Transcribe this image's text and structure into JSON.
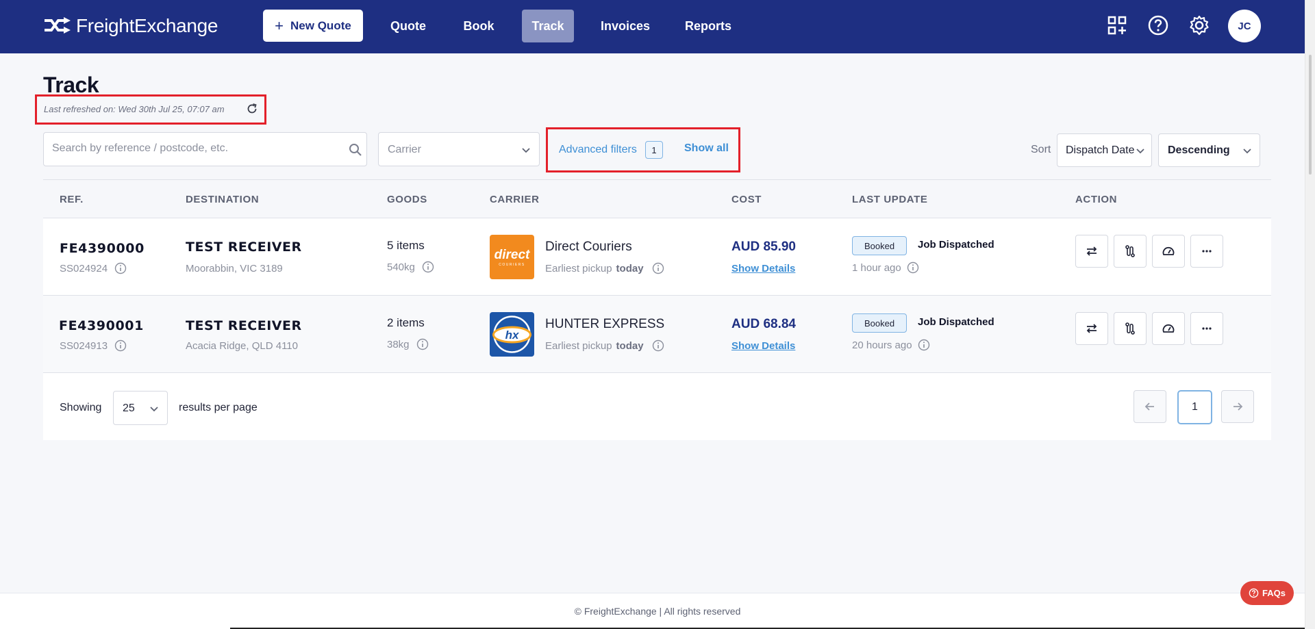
{
  "app": {
    "name": "FreightExchange",
    "user_initials": "JC"
  },
  "nav": {
    "new_quote": "New Quote",
    "items": [
      {
        "label": "Quote"
      },
      {
        "label": "Book"
      },
      {
        "label": "Track",
        "active": true
      },
      {
        "label": "Invoices"
      },
      {
        "label": "Reports"
      }
    ]
  },
  "page": {
    "title": "Track",
    "last_refreshed": "Last refreshed on: Wed 30th Jul 25, 07:07 am"
  },
  "filters": {
    "search_placeholder": "Search by reference / postcode, etc.",
    "carrier_placeholder": "Carrier",
    "advanced_label": "Advanced filters",
    "advanced_count": "1",
    "show_all": "Show all",
    "sort_label": "Sort",
    "sort_value": "Dispatch Date",
    "order_value": "Descending"
  },
  "table": {
    "headers": [
      "REF.",
      "DESTINATION",
      "GOODS",
      "CARRIER",
      "COST",
      "LAST UPDATE",
      "ACTION"
    ],
    "rows": [
      {
        "ref": "FE4390000",
        "sub_ref": "SS024924",
        "dest_name": "TEST RECEIVER",
        "dest_addr": "Moorabbin, VIC 3189",
        "goods": "5 items",
        "weight": "540kg",
        "carrier": "Direct Couriers",
        "pickup_prefix": "Earliest pickup",
        "pickup_day": "today",
        "cost": "AUD 85.90",
        "details": "Show Details",
        "status": "Booked",
        "update": "Job Dispatched",
        "update_time": "1 hour ago",
        "logo_text": "direct",
        "logo_sub": "COURIERS"
      },
      {
        "ref": "FE4390001",
        "sub_ref": "SS024913",
        "dest_name": "TEST RECEIVER",
        "dest_addr": "Acacia Ridge, QLD 4110",
        "goods": "2 items",
        "weight": "38kg",
        "carrier": "HUNTER EXPRESS",
        "pickup_prefix": "Earliest pickup",
        "pickup_day": "today",
        "cost": "AUD 68.84",
        "details": "Show Details",
        "status": "Booked",
        "update": "Job Dispatched",
        "update_time": "20 hours ago",
        "logo_text": "hx"
      }
    ]
  },
  "pagination": {
    "showing": "Showing",
    "per_page": "25",
    "per_page_label": "results per page",
    "current_page": "1"
  },
  "footer": {
    "copyright": "© FreightExchange | All rights reserved",
    "faq": "FAQs"
  },
  "colors": {
    "nav": "#1e2f82",
    "accent": "#3e8fd5",
    "highlight": "#e3202a",
    "faq": "#e0443b"
  }
}
